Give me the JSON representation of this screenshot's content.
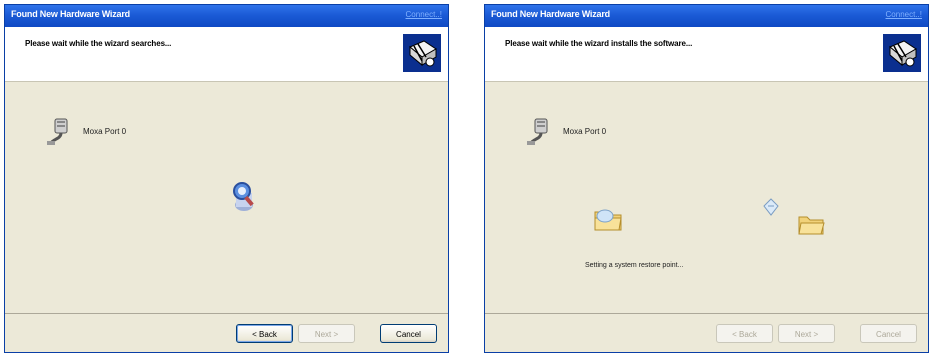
{
  "windows": [
    {
      "title": "Found New Hardware Wizard",
      "title_link": "Connect..!",
      "header_text": "Please wait while the wizard searches...",
      "device_label": "Moxa Port 0",
      "status_text": "",
      "buttons": {
        "back": "< Back",
        "next": "Next >",
        "cancel": "Cancel"
      },
      "buttons_state": {
        "back": "enabled",
        "next": "disabled",
        "cancel": "enabled"
      }
    },
    {
      "title": "Found New Hardware Wizard",
      "title_link": "Connect..!",
      "header_text": "Please wait while the wizard installs the software...",
      "device_label": "Moxa Port 0",
      "status_text": "Setting a system restore point...",
      "buttons": {
        "back": "< Back",
        "next": "Next >",
        "cancel": "Cancel"
      },
      "buttons_state": {
        "back": "disabled",
        "next": "disabled",
        "cancel": "disabled"
      }
    }
  ],
  "icons": {
    "header": "hardware-wizard-icon",
    "device": "serial-port-icon",
    "search": "searching-magnifier-icon",
    "folder_source": "folder-icon",
    "folder_target": "folder-icon",
    "flying_page": "document-icon"
  },
  "colors": {
    "titlebar": "#1b5bd6",
    "window_bg": "#ece9d8",
    "header_bg": "#ffffff"
  }
}
